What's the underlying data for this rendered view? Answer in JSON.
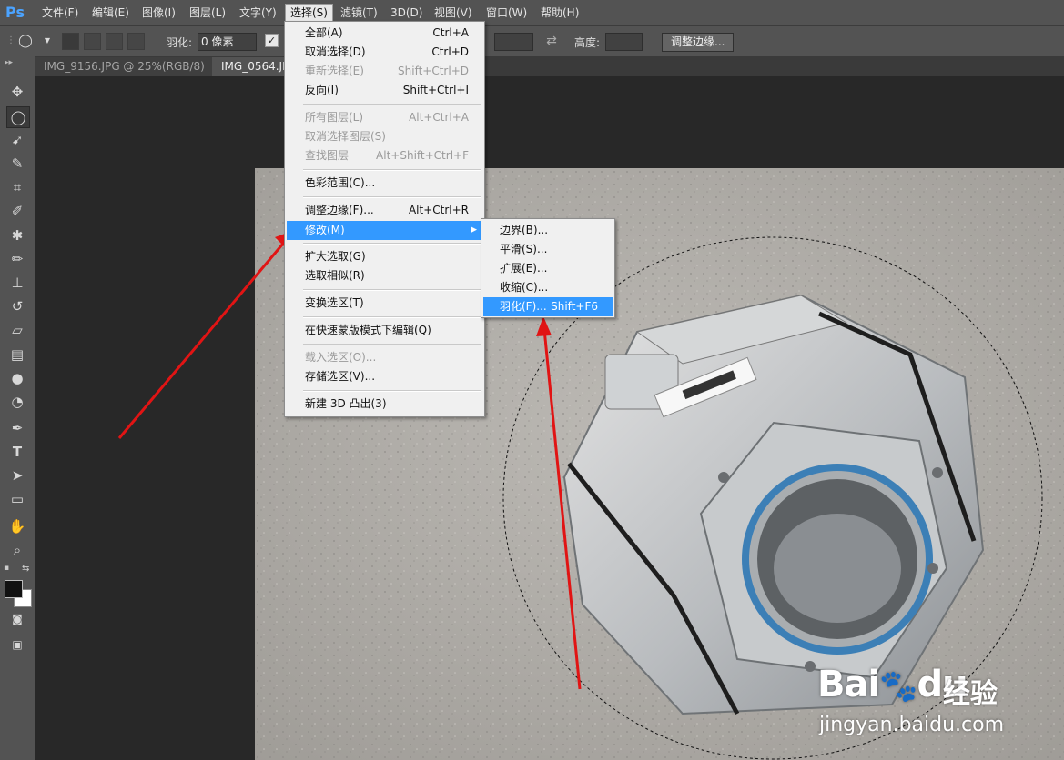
{
  "app": {
    "logo": "Ps"
  },
  "menubar": {
    "items": [
      "文件(F)",
      "编辑(E)",
      "图像(I)",
      "图层(L)",
      "文字(Y)",
      "选择(S)",
      "滤镜(T)",
      "3D(D)",
      "视图(V)",
      "窗口(W)",
      "帮助(H)"
    ],
    "active_index": 5
  },
  "options": {
    "feather_label": "羽化:",
    "feather_value": "0 像素",
    "height_label": "高度:",
    "refine_edge_button": "调整边缘..."
  },
  "tabs": [
    {
      "label": "IMG_9156.JPG @ 25%(RGB/8)",
      "close": "×",
      "active": false
    },
    {
      "label": "IMG_0564.JP",
      "active": true
    }
  ],
  "select_menu": {
    "items": [
      {
        "label": "全部(A)",
        "shortcut": "Ctrl+A",
        "disabled": false
      },
      {
        "label": "取消选择(D)",
        "shortcut": "Ctrl+D",
        "disabled": false
      },
      {
        "label": "重新选择(E)",
        "shortcut": "Shift+Ctrl+D",
        "disabled": true
      },
      {
        "label": "反向(I)",
        "shortcut": "Shift+Ctrl+I",
        "disabled": false
      },
      {
        "label": "所有图层(L)",
        "shortcut": "Alt+Ctrl+A",
        "disabled": true
      },
      {
        "label": "取消选择图层(S)",
        "shortcut": "",
        "disabled": true
      },
      {
        "label": "查找图层",
        "shortcut": "Alt+Shift+Ctrl+F",
        "disabled": true
      },
      {
        "label": "色彩范围(C)...",
        "shortcut": "",
        "disabled": false
      },
      {
        "label": "调整边缘(F)...",
        "shortcut": "Alt+Ctrl+R",
        "disabled": false
      },
      {
        "label": "修改(M)",
        "shortcut": "",
        "disabled": false,
        "submenu_arrow": "▶"
      },
      {
        "label": "扩大选取(G)",
        "shortcut": "",
        "disabled": false
      },
      {
        "label": "选取相似(R)",
        "shortcut": "",
        "disabled": false
      },
      {
        "label": "变换选区(T)",
        "shortcut": "",
        "disabled": false
      },
      {
        "label": "在快速蒙版模式下编辑(Q)",
        "shortcut": "",
        "disabled": false
      },
      {
        "label": "载入选区(O)...",
        "shortcut": "",
        "disabled": true
      },
      {
        "label": "存储选区(V)...",
        "shortcut": "",
        "disabled": false
      },
      {
        "label": "新建 3D 凸出(3)",
        "shortcut": "",
        "disabled": false
      }
    ]
  },
  "modify_submenu": {
    "items": [
      {
        "label": "边界(B)...",
        "shortcut": ""
      },
      {
        "label": "平滑(S)...",
        "shortcut": ""
      },
      {
        "label": "扩展(E)...",
        "shortcut": ""
      },
      {
        "label": "收缩(C)...",
        "shortcut": ""
      },
      {
        "label": "羽化(F)...",
        "shortcut": "Shift+F6"
      }
    ]
  },
  "tools": [
    "move-tool-icon",
    "elliptical-marquee-icon",
    "lasso-icon",
    "quick-select-icon",
    "crop-icon",
    "eyedropper-icon",
    "healing-brush-icon",
    "brush-icon",
    "clone-stamp-icon",
    "history-brush-icon",
    "eraser-icon",
    "gradient-icon",
    "blur-icon",
    "dodge-icon",
    "pen-icon",
    "type-icon",
    "path-select-icon",
    "shape-icon",
    "hand-icon",
    "zoom-icon"
  ],
  "watermark": {
    "brand": "Bai",
    "brand_suffix": "du",
    "product": "经验",
    "url": "jingyan.baidu.com"
  },
  "colors": {
    "highlight": "#3399ff",
    "arrow": "#e11414",
    "panel": "#535353",
    "canvas": "#282828"
  }
}
